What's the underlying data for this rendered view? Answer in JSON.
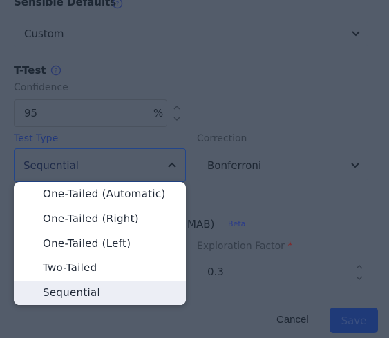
{
  "sensible_defaults": {
    "heading": "Sensible Defaults",
    "value": "Custom"
  },
  "ttest": {
    "heading": "T-Test",
    "confidence_label": "Confidence",
    "confidence_value": "95",
    "confidence_unit": "%",
    "test_type_label": "Test Type",
    "test_type_value": "Sequential",
    "correction_label": "Correction",
    "correction_value": "Bonferroni"
  },
  "mab": {
    "heading_fragment": "MAB)",
    "badge": "Beta",
    "exploration_label": "Exploration Factor",
    "exploration_required": "*",
    "exploration_value": "0.3"
  },
  "test_type_menu": {
    "options": [
      "One-Tailed (Automatic)",
      "One-Tailed (Right)",
      "One-Tailed (Left)",
      "Two-Tailed",
      "Sequential"
    ],
    "selected": "Sequential"
  },
  "actions": {
    "cancel": "Cancel",
    "save": "Save"
  }
}
